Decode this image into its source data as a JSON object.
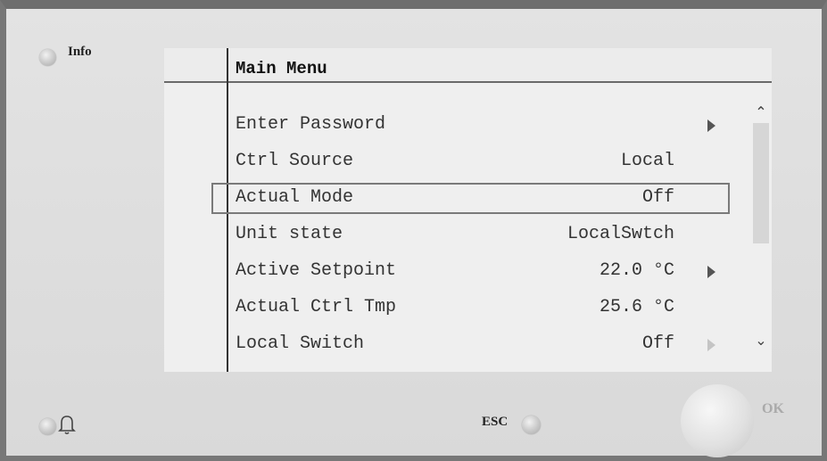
{
  "panel": {
    "info_label": "Info",
    "esc_label": "ESC",
    "ok_label": "OK",
    "bell_icon": "bell-icon"
  },
  "screen": {
    "title": "Main Menu",
    "rows": [
      {
        "label": "Enter Password",
        "value": "",
        "arrow": "filled"
      },
      {
        "label": "Ctrl Source",
        "value": "Local",
        "arrow": ""
      },
      {
        "label": "Actual Mode",
        "value": "Off",
        "arrow": "",
        "selected": true
      },
      {
        "label": "Unit state",
        "value": "LocalSwtch",
        "arrow": ""
      },
      {
        "label": "Active Setpoint",
        "value": "22.0 °C",
        "arrow": "filled"
      },
      {
        "label": "Actual Ctrl Tmp",
        "value": "25.6 °C",
        "arrow": ""
      },
      {
        "label": "Local Switch",
        "value": "Off",
        "arrow": "hollow"
      }
    ],
    "scroll_up_icon": "chevron-up-icon",
    "scroll_down_icon": "chevron-down-icon"
  },
  "colors": {
    "bezel": "#dcdcdc",
    "screen_bg": "#efefef",
    "border": "#6e6e6e"
  }
}
